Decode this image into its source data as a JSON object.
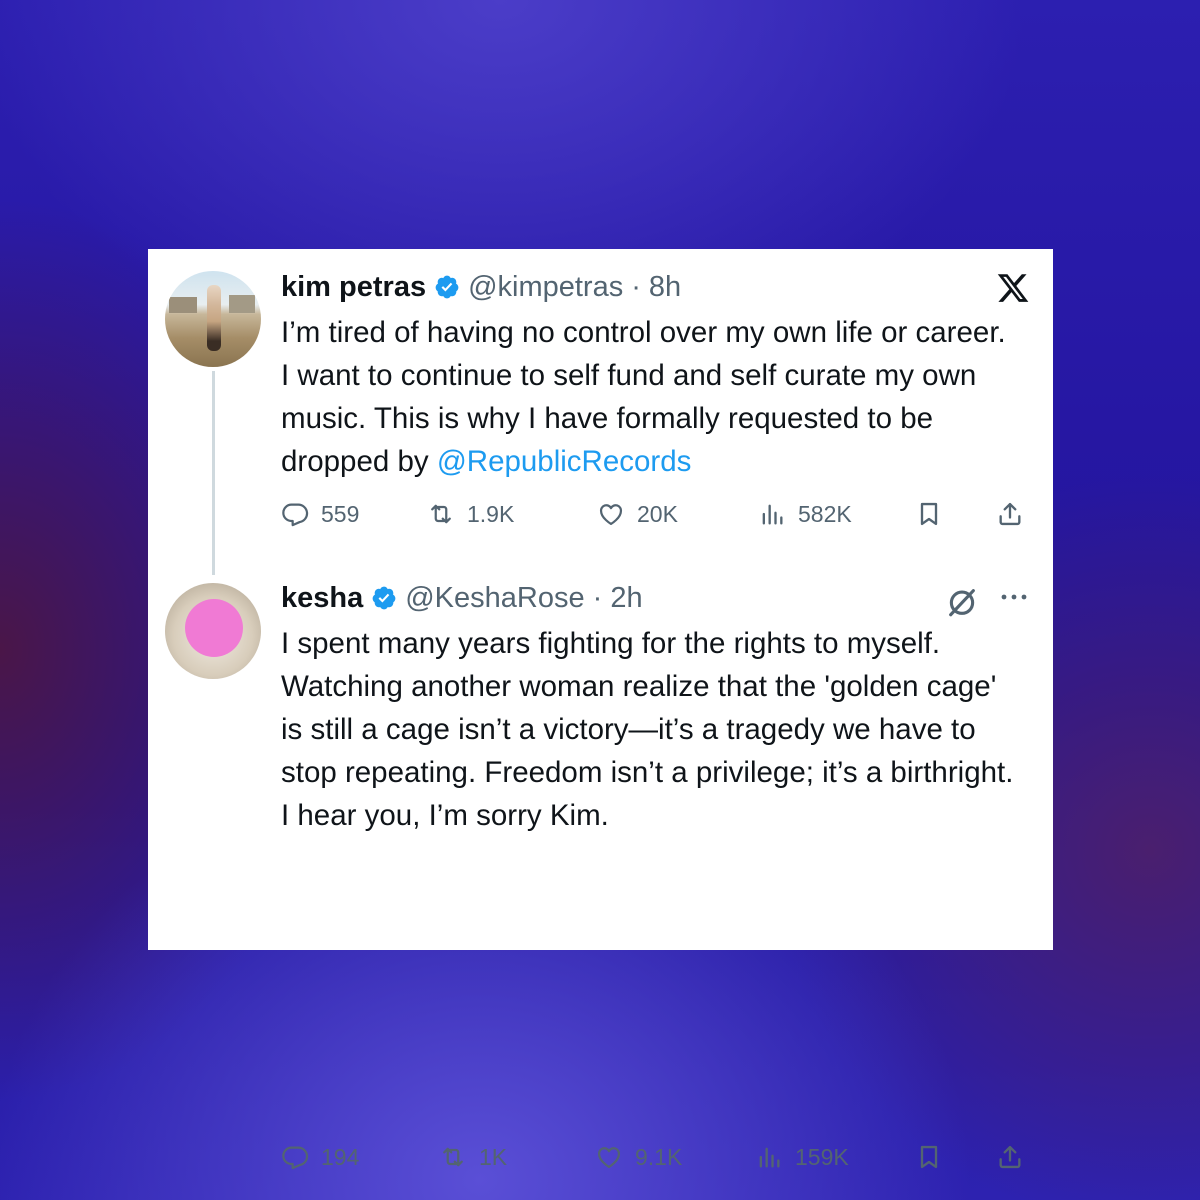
{
  "tweets": [
    {
      "name": "kim petras",
      "handle": "@kimpetras",
      "time": "· 8h",
      "text_before_mention": "I’m tired of having no control over my own life or career. I want to continue to self fund and self curate my own music. This is why I have formally requested to be dropped by ",
      "mention": "@RepublicRecords",
      "replies": "559",
      "reposts": "1.9K",
      "likes": "20K",
      "views": "582K"
    },
    {
      "name": "kesha",
      "handle": "@KeshaRose",
      "time": "· 2h",
      "text": "I spent many years fighting for the rights to myself. Watching another woman realize that the 'golden cage' is still a cage isn’t a victory—it’s a tragedy we have to stop repeating. Freedom isn’t a privilege; it’s a birthright. I hear you, I’m sorry Kim.",
      "replies": "194",
      "reposts": "1K",
      "likes": "9.1K",
      "views": "159K"
    }
  ],
  "icons": {
    "brand": "x-logo-icon",
    "verified": "verified-badge-icon",
    "reply": "reply-icon",
    "repost": "repost-icon",
    "like": "like-icon",
    "views": "views-icon",
    "bookmark": "bookmark-icon",
    "share": "share-icon",
    "grok": "grok-icon",
    "more": "more-icon"
  },
  "colors": {
    "verified": "#1d9bf0",
    "mention": "#1d9bf0",
    "text": "#0f1419",
    "muted": "#536471",
    "redaction": "#f07ad4"
  }
}
